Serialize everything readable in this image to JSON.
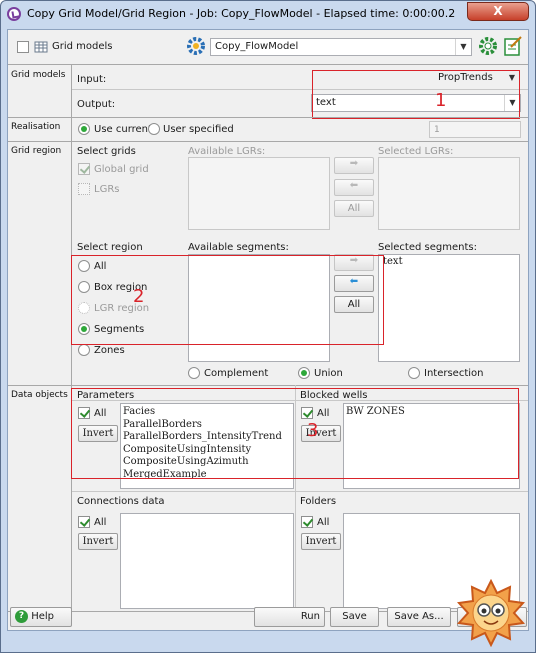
{
  "window": {
    "title": "Copy Grid Model/Grid Region - Job: Copy_FlowModel - Elapsed time: 0:00:00.2",
    "close_label": "X"
  },
  "toolbar": {
    "grid_models_label": "Grid models",
    "job_name": "Copy_FlowModel"
  },
  "grid_models": {
    "section_label": "Grid models",
    "input_label": "Input:",
    "input_value": "PropTrends",
    "output_label": "Output:",
    "output_value": "text"
  },
  "realisation": {
    "section_label": "Realisation",
    "use_current": "Use current",
    "user_specified": "User specified",
    "number": "1"
  },
  "grid_region": {
    "section_label": "Grid region",
    "select_grids_label": "Select grids",
    "global_grid": "Global grid",
    "lgrs": "LGRs",
    "available_lgrs_label": "Available LGRs:",
    "selected_lgrs_label": "Selected LGRs:",
    "all_label": "All",
    "select_region_label": "Select region",
    "region_options": [
      "All",
      "Box region",
      "LGR region",
      "Segments",
      "Zones"
    ],
    "available_segments_label": "Available segments:",
    "selected_segments_label": "Selected segments:",
    "selected_segments": [
      "text"
    ],
    "complement": "Complement",
    "union": "Union",
    "intersection": "Intersection"
  },
  "data_objects": {
    "section_label": "Data objects",
    "parameters_label": "Parameters",
    "all_label": "All",
    "invert_label": "Invert",
    "parameters": [
      "Facies",
      "ParallelBorders",
      "ParallelBorders_IntensityTrend",
      "CompositeUsingIntensity",
      "CompositeUsingAzimuth",
      "MergedExample"
    ],
    "blocked_wells_label": "Blocked wells",
    "blocked_wells": [
      "BW ZONES"
    ],
    "connections_label": "Connections data",
    "folders_label": "Folders"
  },
  "footer": {
    "help": "Help",
    "run": "Run",
    "save": "Save",
    "save_as": "Save As..."
  },
  "annotations": {
    "one": "1",
    "two": "2",
    "three": "3"
  },
  "colors": {
    "annotation_red": "#d9232a",
    "radio_green": "#2ea83a"
  }
}
